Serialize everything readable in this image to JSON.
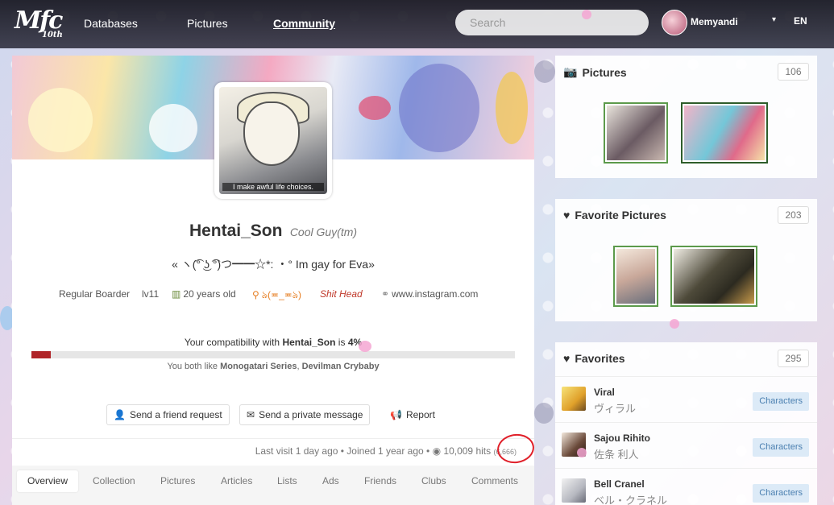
{
  "nav": {
    "logo": "Mfc",
    "logo_sub": "10th",
    "links": [
      "Databases",
      "Pictures",
      "Community"
    ],
    "search_placeholder": "Search",
    "username": "Memyandi",
    "caret": "▾",
    "lang": "EN"
  },
  "profile": {
    "avatar_caption": "I make awful life choices.",
    "name": "Hentai_Son",
    "title": "Cool Guy(tm)",
    "tagline": "« ヽ(͡° ͜ʖ ͡°)つ━━☆*: ・° Im gay for Eva»",
    "meta": {
      "rank": "Regular Boarder",
      "level": "lv11",
      "age": "20 years old",
      "location": "ঌ(≖_≖ঌ)",
      "status": "Shit Head",
      "website": "www.instagram.com"
    },
    "compat_prefix": "Your compatibility with ",
    "compat_name": "Hentai_Son",
    "compat_mid": " is ",
    "compat_value": "4%",
    "compat_percent": 4,
    "likes_prefix": "You both like ",
    "likes_1": "Monogatari Series",
    "likes_sep": ", ",
    "likes_2": "Devilman Crybaby",
    "buttons": {
      "friend": "Send a friend request",
      "message": "Send a private message",
      "report": "Report"
    },
    "stats": {
      "text": "Last visit 1 day ago • Joined 1 year ago • ",
      "hits": "10,009 hits",
      "extra": "(6,666)"
    },
    "tabs": [
      "Overview",
      "Collection",
      "Pictures",
      "Articles",
      "Lists",
      "Ads",
      "Friends",
      "Clubs",
      "Comments"
    ]
  },
  "sidebar": {
    "pictures": {
      "title": "Pictures",
      "count": "106"
    },
    "favorite_pictures": {
      "title": "Favorite Pictures",
      "count": "203"
    },
    "favorites": {
      "title": "Favorites",
      "count": "295",
      "items": [
        {
          "name": "Viral",
          "jp": "ヴィラル",
          "badge": "Characters"
        },
        {
          "name": "Sajou Rihito",
          "jp": "佐条 利人",
          "badge": "Characters"
        },
        {
          "name": "Bell Cranel",
          "jp": "ベル・クラネル",
          "badge": "Characters"
        }
      ]
    }
  },
  "colors": {
    "accent_red": "#b02428",
    "thumb_border": "#5c9a4b",
    "badge_bg": "#dceaf7"
  }
}
